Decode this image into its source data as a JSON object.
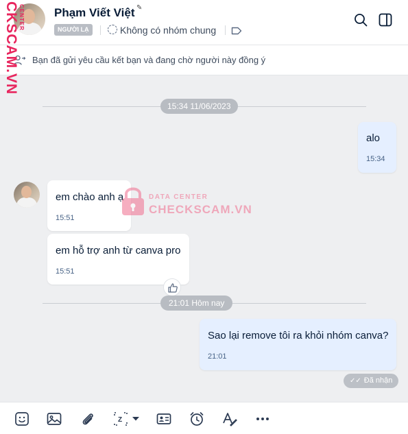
{
  "header": {
    "name": "Phạm Viết Việt",
    "badge": "NGƯỜI LẠ",
    "group_status": "Không có nhóm chung"
  },
  "friend_request": {
    "text": "Bạn đã gửi yêu cầu kết bạn và đang chờ người này đồng ý"
  },
  "watermark": {
    "vertical": "CKSCAM.VN",
    "vertical_small": "CENTER",
    "small": "DATA CENTER",
    "big": "CHECKSCAM.VN"
  },
  "separators": [
    {
      "label": "15:34 11/06/2023"
    },
    {
      "label": "21:01 Hôm nay"
    }
  ],
  "messages": [
    {
      "direction": "out",
      "text": "alo",
      "time": "15:34"
    },
    {
      "direction": "in",
      "text": "em chào anh ạ",
      "time": "15:51"
    },
    {
      "direction": "in",
      "text": "em hỗ trợ anh từ canva pro",
      "time": "15:51"
    },
    {
      "direction": "out",
      "text": "Sao lại remove tôi ra khỏi nhóm canva?",
      "time": "21:01"
    }
  ],
  "status": {
    "received": "Đã nhận"
  },
  "toolbar": {
    "icons": [
      "sticker-icon",
      "image-icon",
      "attachment-icon",
      "screenshot-icon",
      "business-card-icon",
      "reminder-icon",
      "text-format-icon",
      "more-icon"
    ]
  },
  "colors": {
    "accent": "#0068ff",
    "watermark": "#e8265e",
    "outgoing_bubble": "#e5efff"
  }
}
